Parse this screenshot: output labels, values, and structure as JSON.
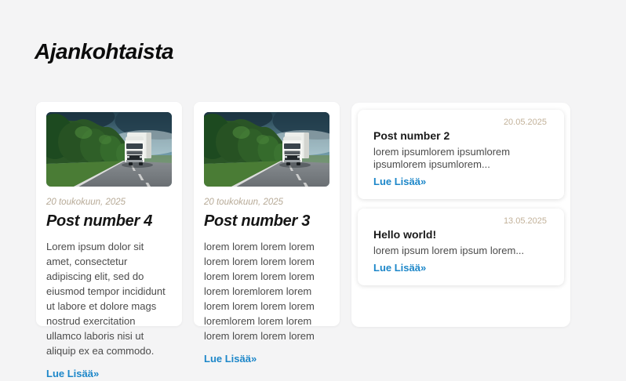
{
  "page": {
    "title": "Ajankohtaista",
    "background_color": "#f4f4f5"
  },
  "colors": {
    "card_background": "#ffffff",
    "date_text": "#b7aa97",
    "body_text": "#4b4b4b",
    "title_text": "#151515",
    "link_blue": "#1d87c9"
  },
  "posts": [
    {
      "date": "20 toukokuun, 2025",
      "title": "Post number 4",
      "excerpt": "Lorem ipsum dolor sit amet, consectetur adipiscing elit, sed do eiusmod tempor incididunt ut labore et dolore mags nostrud exercitation ullamco laboris nisi ut aliquip ex ea commodo.",
      "link_label": "Lue Lisää»",
      "image": "white-truck-driving-on-road-with-green-trees-and-dark-cloudy-sky"
    },
    {
      "date": "20 toukokuun, 2025",
      "title": "Post number 3",
      "excerpt": "lorem lorem lorem lorem lorem lorem lorem lorem lorem lorem lorem lorem lorem loremlorem lorem lorem lorem lorem lorem loremlorem lorem lorem lorem lorem lorem lorem",
      "link_label": "Lue Lisää»",
      "image": "white-truck-driving-on-road-with-green-trees-and-dark-cloudy-sky"
    }
  ],
  "sidebar_posts": [
    {
      "date": "20.05.2025",
      "title": "Post number 2",
      "excerpt": "lorem ipsumlorem ipsumlorem ipsumlorem ipsumlorem...",
      "link_label": "Lue Lisää»"
    },
    {
      "date": "13.05.2025",
      "title": "Hello world!",
      "excerpt": "lorem ipsum lorem ipsum lorem...",
      "link_label": "Lue Lisää»"
    }
  ]
}
